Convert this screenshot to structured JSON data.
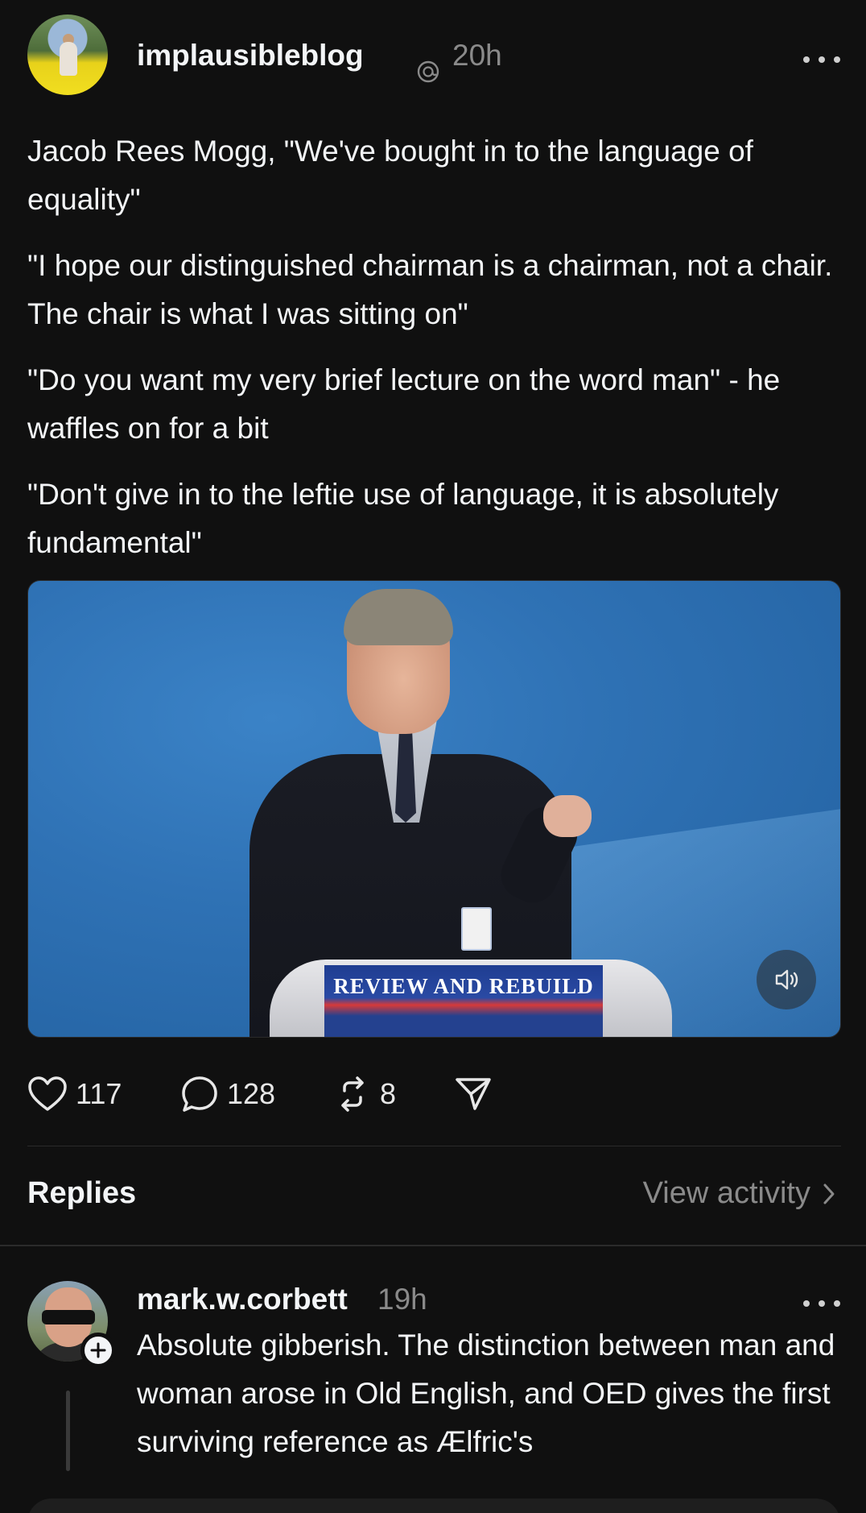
{
  "post": {
    "username": "implausibleblog",
    "time": "20h",
    "paragraphs": [
      "Jacob Rees Mogg, \"We've bought in to the language of equality\"",
      "\"I hope our distinguished chairman is a chairman, not a chair. The chair is what I was sitting on\"",
      "\"Do you want my very brief lecture on the word man\" - he waffles on for a bit",
      "\"Don't give in to the leftie use of language, it is absolutely fundamental\""
    ],
    "video": {
      "banner_text": "REVIEW AND REBUILD"
    },
    "actions": {
      "likes": "117",
      "comments": "128",
      "reposts": "8"
    }
  },
  "replies_section": {
    "title": "Replies",
    "view_activity": "View activity"
  },
  "reply": {
    "username": "mark.w.corbett",
    "time": "19h",
    "text": "Absolute gibberish. The distinction between man and woman arose in Old English, and OED gives the first surviving reference as Ælfric's"
  },
  "colors": {
    "background": "#101010",
    "text": "#f3f5f7",
    "secondary_text": "#8a8a8a",
    "divider": "#2b2b2b"
  }
}
